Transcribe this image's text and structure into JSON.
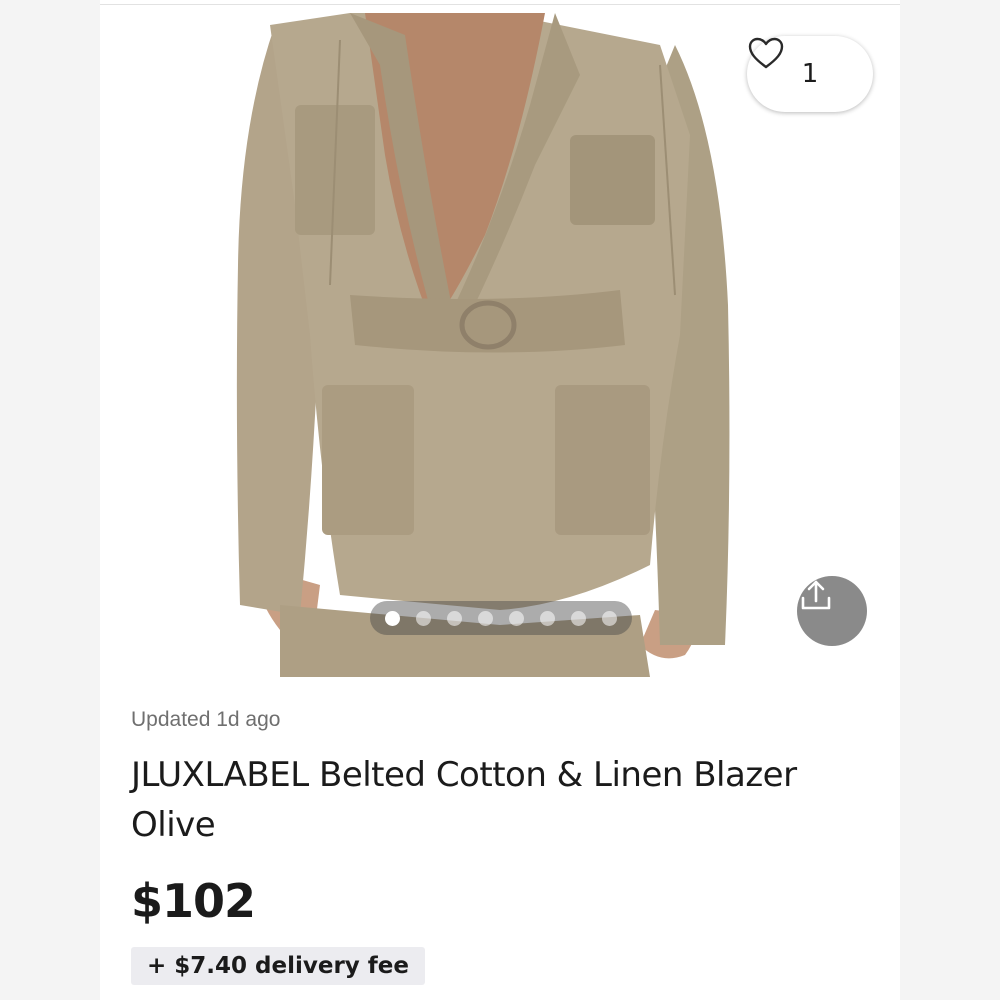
{
  "listing": {
    "like_count": "1",
    "updated_text": "Updated 1d ago",
    "title": "JLUXLABEL Belted Cotton & Linen Blazer Olive",
    "price": "$102",
    "delivery_fee": "+ $7.40 delivery fee"
  },
  "gallery": {
    "image_count": 8,
    "active_index": 0
  },
  "icons": {
    "like": "heart-outline-icon",
    "share": "share-upload-icon"
  },
  "colors": {
    "blazer": "#b4a68c",
    "share_bg": "#8a8a8a",
    "fee_bg": "#ececf0",
    "text": "#1b1b1b",
    "muted": "#6f6f6f"
  }
}
